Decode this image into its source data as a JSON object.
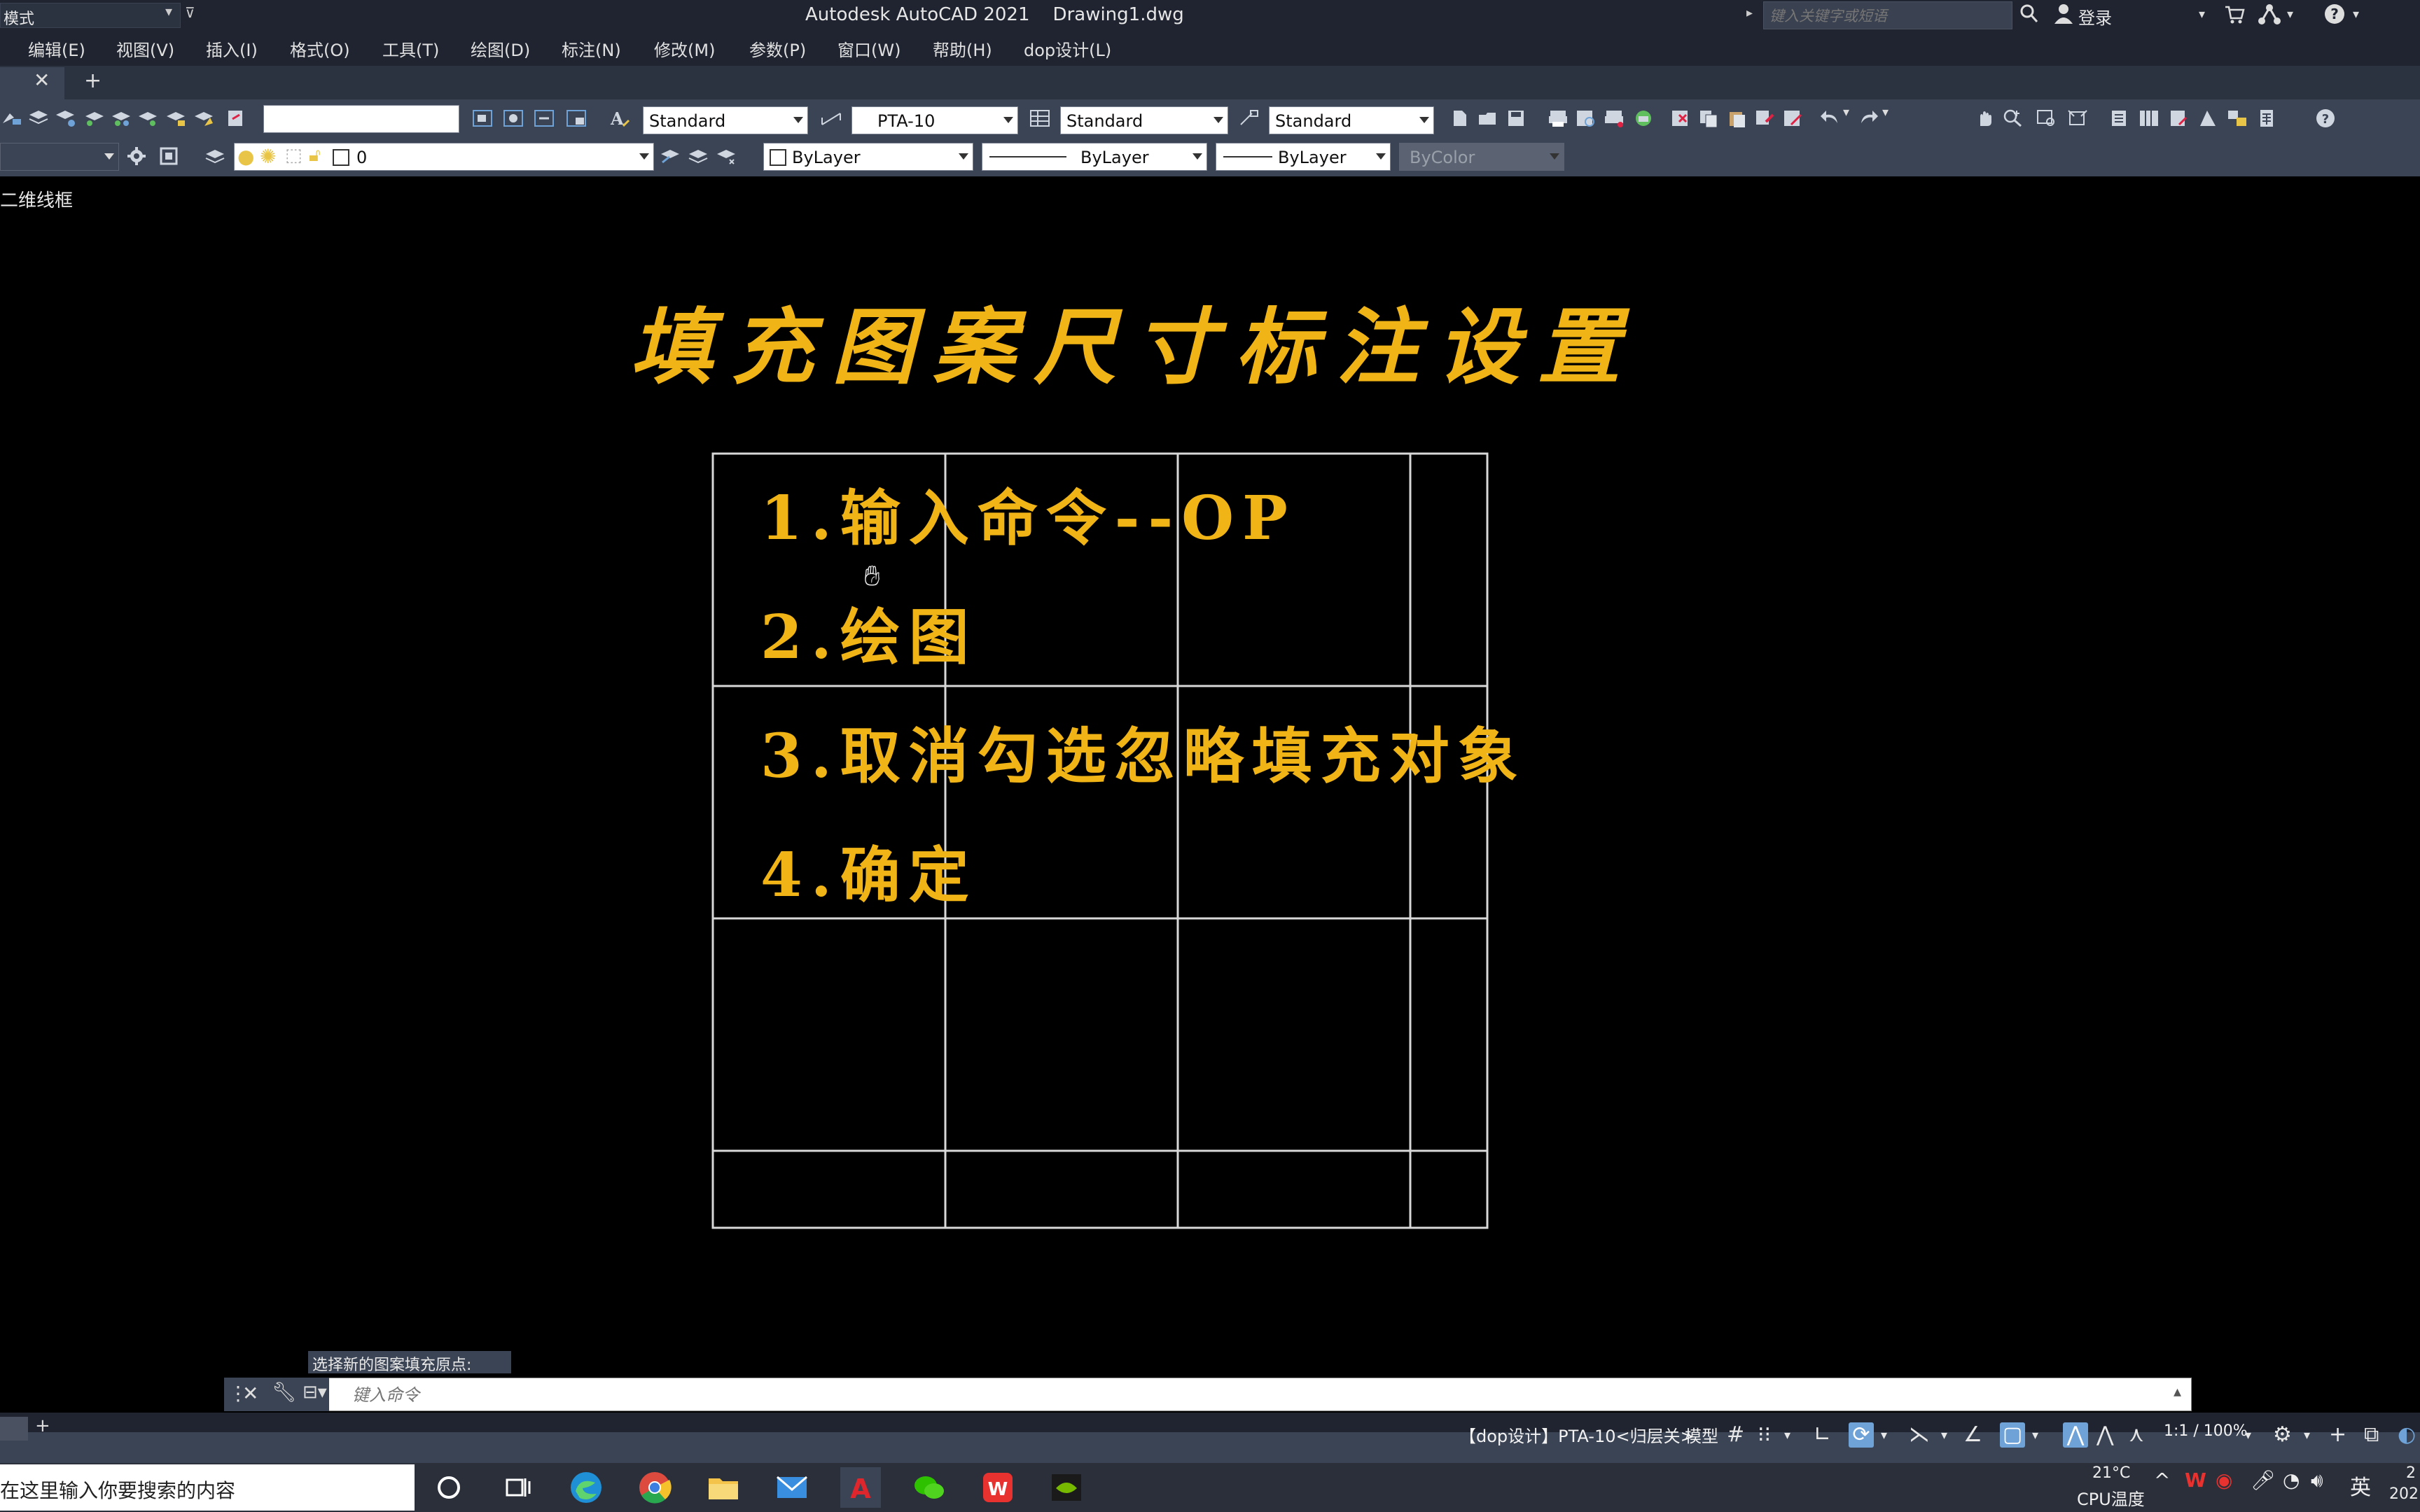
{
  "titlebar": {
    "workspace": "模式",
    "app_title": "Autodesk AutoCAD 2021    Drawing1.dwg",
    "search_placeholder": "键入关键字或短语",
    "login": "登录"
  },
  "menu": [
    "编辑(E)",
    "视图(V)",
    "插入(I)",
    "格式(O)",
    "工具(T)",
    "绘图(D)",
    "标注(N)",
    "修改(M)",
    "参数(P)",
    "窗口(W)",
    "帮助(H)",
    "dop设计(L)"
  ],
  "toolbar1": {
    "text_style": "Standard",
    "dim_style": "PTA-10",
    "table_style": "Standard",
    "mleader_style": "Standard"
  },
  "toolbar2": {
    "layer": "0",
    "color": "ByLayer",
    "linetype": "ByLayer",
    "lineweight": "ByLayer",
    "plotstyle": "ByColor"
  },
  "canvas": {
    "viewport_label": "二维线框",
    "title": "填充图案尺寸标注设置",
    "steps": [
      "1.输入命令--OP",
      "2.绘图",
      "3.取消勾选忽略填充对象",
      "4.确定"
    ]
  },
  "command": {
    "prompt": "选择新的图案填充原点:",
    "input_placeholder": "键入命令"
  },
  "status": {
    "annotation_text": "【dop设计】PTA-10<归层关>",
    "model": "模型",
    "scale": "1:1 / 100%"
  },
  "taskbar": {
    "search_text": "在这里输入你要搜索的内容",
    "temp": "21°C",
    "cpu": "CPU温度",
    "ime": "英",
    "clock_top": "2",
    "clock_bot": "202"
  },
  "colors": {
    "accent_text": "#f0b416",
    "toolbar_bg": "#3b4454",
    "title_bg": "#1f2430"
  }
}
